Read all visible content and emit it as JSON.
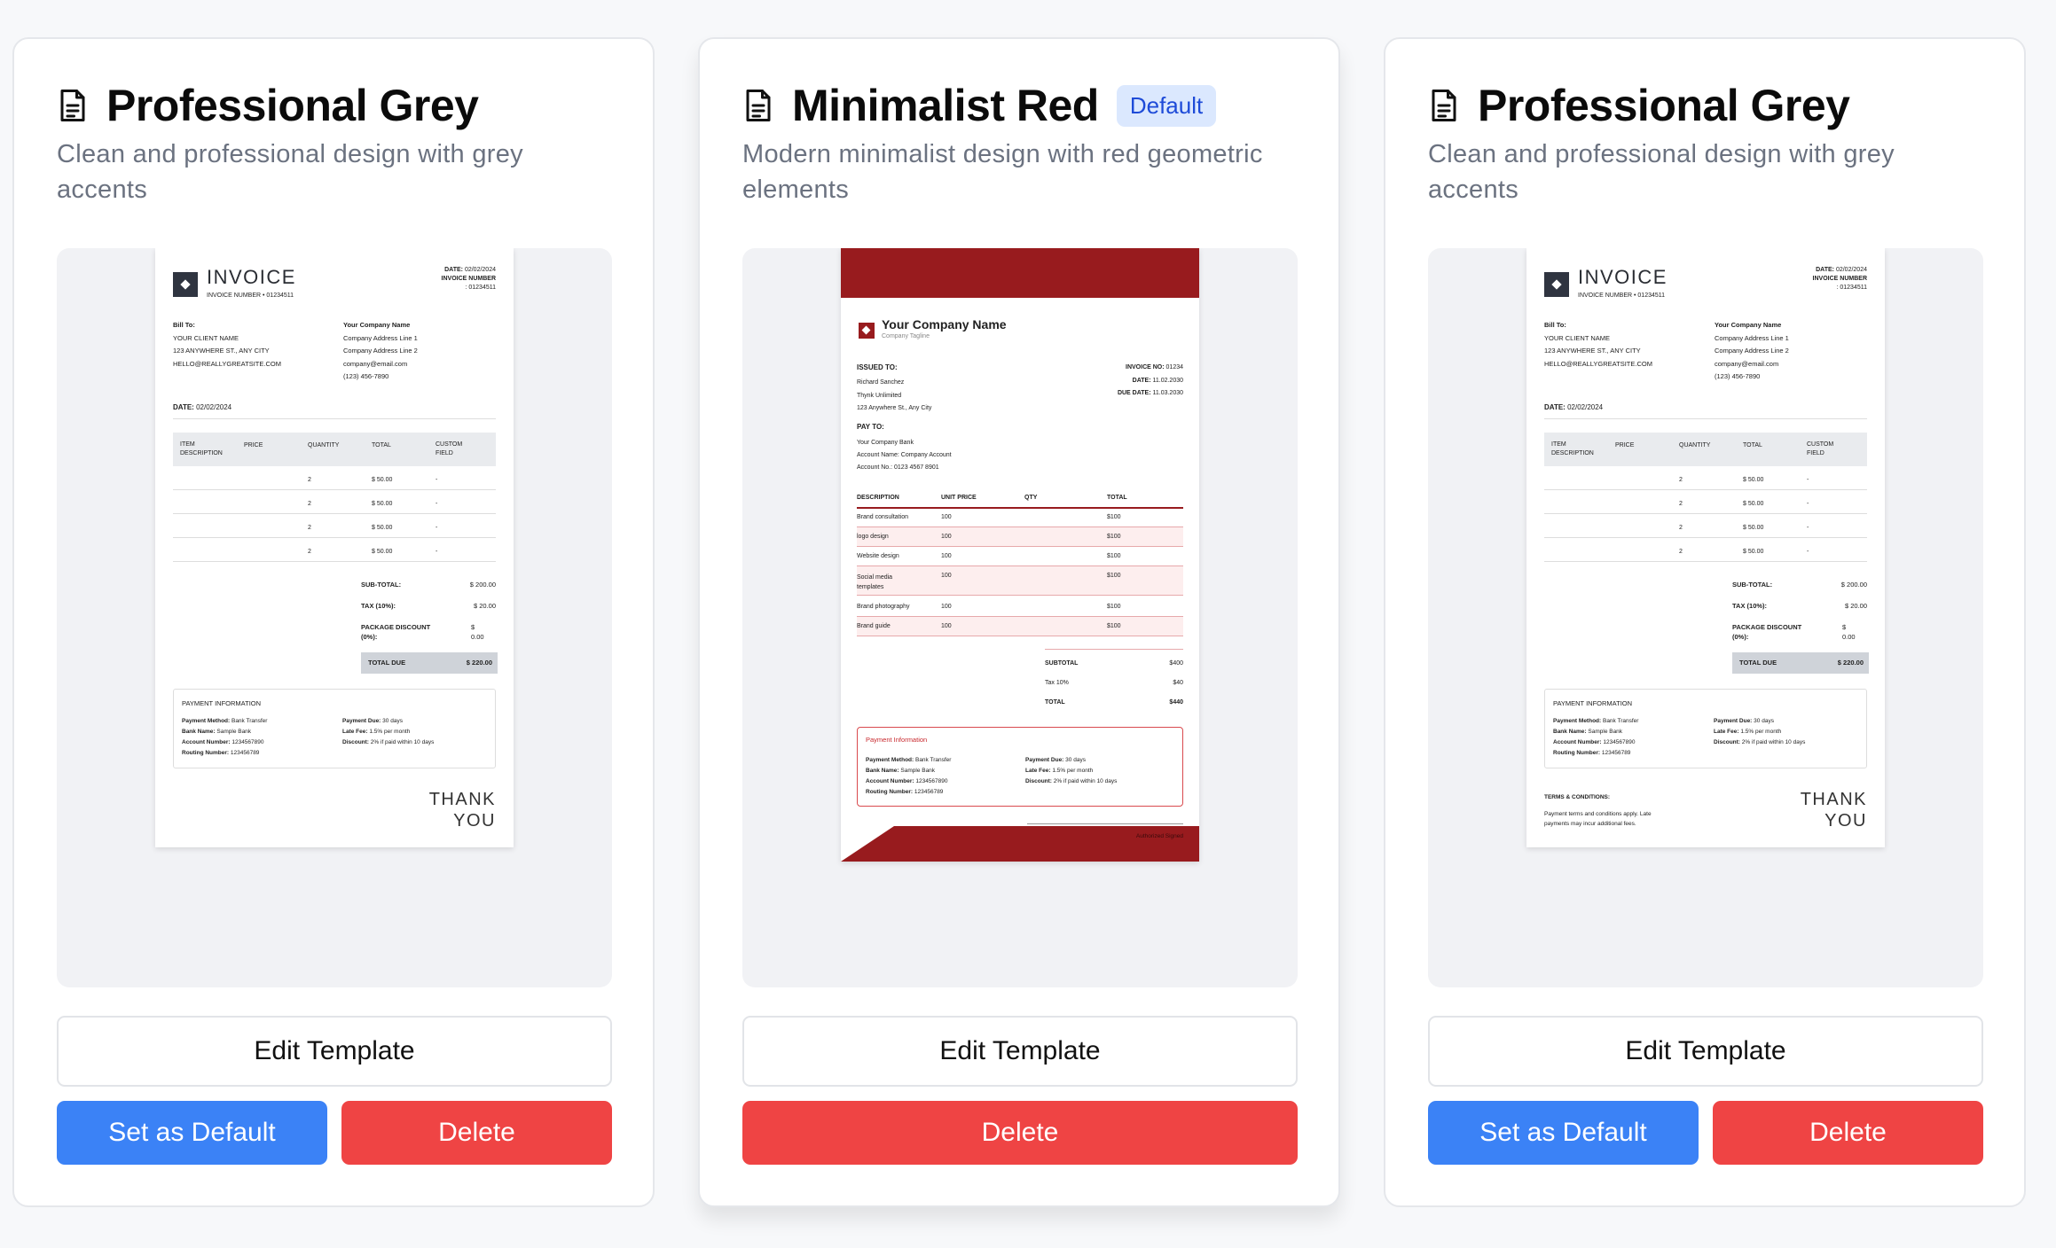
{
  "cards": [
    {
      "title": "Professional Grey",
      "description": "Clean and professional design with grey accents",
      "badge": "",
      "buttons": {
        "edit": "Edit Template",
        "set_default": "Set as Default",
        "delete": "Delete"
      }
    },
    {
      "title": "Minimalist Red",
      "description": "Modern minimalist design with red geometric elements",
      "badge": "Default",
      "buttons": {
        "edit": "Edit Template",
        "delete": "Delete"
      }
    },
    {
      "title": "Professional Grey",
      "description": "Clean and professional design with grey accents",
      "badge": "",
      "buttons": {
        "edit": "Edit Template",
        "set_default": "Set as Default",
        "delete": "Delete"
      }
    }
  ],
  "grey_invoice": {
    "title": "INVOICE",
    "invoice_number_line": "INVOICE NUMBER • 01234511",
    "date_label": "DATE:",
    "date_value": "02/02/2024",
    "inv_num_label": "INVOICE NUMBER",
    "inv_num_value": ": 01234511",
    "bill_to_label": "Bill To:",
    "client_name": "YOUR CLIENT NAME",
    "client_address": "123 ANYWHERE ST., ANY CITY",
    "client_email": "HELLO@REALLYGREATSITE.COM",
    "company_name": "Your Company Name",
    "company_line1": "Company Address Line 1",
    "company_line2": "Company Address Line 2",
    "company_email": "company@email.com",
    "company_phone": "(123) 456-7890",
    "body_date_label": "DATE:",
    "body_date_value": "02/02/2024",
    "table_headers": [
      "ITEM DESCRIPTION",
      "PRICE",
      "QUANTITY",
      "TOTAL",
      "CUSTOM FIELD"
    ],
    "rows": [
      {
        "qty": "2",
        "total": "$ 50.00",
        "custom": "-"
      },
      {
        "qty": "2",
        "total": "$ 50.00",
        "custom": "-"
      },
      {
        "qty": "2",
        "total": "$ 50.00",
        "custom": "-"
      },
      {
        "qty": "2",
        "total": "$ 50.00",
        "custom": "-"
      }
    ],
    "subtotal_label": "SUB-TOTAL:",
    "subtotal_value": "$ 200.00",
    "tax_label": "TAX (10%):",
    "tax_value": "$ 20.00",
    "discount_label1": "PACKAGE DISCOUNT",
    "discount_label2": "(0%):",
    "discount_value1": "$",
    "discount_value2": "0.00",
    "total_due_label": "TOTAL DUE",
    "total_due_value": "$ 220.00",
    "payment_title": "PAYMENT INFORMATION",
    "pay_left": [
      {
        "k": "Payment Method:",
        "v": "Bank Transfer"
      },
      {
        "k": "Bank Name:",
        "v": "Sample Bank"
      },
      {
        "k": "Account Number:",
        "v": "1234567890"
      },
      {
        "k": "Routing Number:",
        "v": "123456789"
      }
    ],
    "pay_right": [
      {
        "k": "Payment Due:",
        "v": "30 days"
      },
      {
        "k": "Late Fee:",
        "v": "1.5% per month"
      },
      {
        "k": "Discount:",
        "v": "2% if paid within 10 days"
      }
    ],
    "thank1": "THANK",
    "thank2": "YOU",
    "terms_title": "TERMS & CONDITIONS:",
    "terms_text1": "Payment terms and conditions apply. Late",
    "terms_text2": "payments may incur additional fees."
  },
  "red_invoice": {
    "company_name": "Your Company Name",
    "tagline": "Company Tagline",
    "issued_to_label": "ISSUED TO:",
    "issued_lines": [
      "Richard Sanchez",
      "Thynk Unlimited",
      "123 Anywhere St., Any City"
    ],
    "invoice_no_label": "INVOICE NO:",
    "invoice_no_value": "01234",
    "date_label": "DATE:",
    "date_value": "11.02.2030",
    "due_label": "DUE DATE:",
    "due_value": "11.03.2030",
    "pay_to_label": "PAY TO:",
    "pay_lines": [
      "Your Company Bank",
      "Account Name: Company Account",
      "Account No.: 0123 4567 8901"
    ],
    "headers": [
      "DESCRIPTION",
      "UNIT PRICE",
      "QTY",
      "TOTAL"
    ],
    "items": [
      {
        "d": "Brand consultation",
        "p": "100",
        "t": "$100"
      },
      {
        "d": "logo design",
        "p": "100",
        "t": "$100"
      },
      {
        "d": "Website design",
        "p": "100",
        "t": "$100"
      },
      {
        "d": "Social media templates",
        "p": "100",
        "t": "$100"
      },
      {
        "d": "Brand photography",
        "p": "100",
        "t": "$100"
      },
      {
        "d": "Brand guide",
        "p": "100",
        "t": "$100"
      }
    ],
    "subtotal_label": "SUBTOTAL",
    "subtotal_value": "$400",
    "tax_label": "Tax 10%",
    "tax_value": "$40",
    "total_label": "TOTAL",
    "total_value": "$440",
    "payment_title": "Payment Information",
    "pay_left": [
      {
        "k": "Payment Method:",
        "v": "Bank Transfer"
      },
      {
        "k": "Bank Name:",
        "v": "Sample Bank"
      },
      {
        "k": "Account Number:",
        "v": "1234567890"
      },
      {
        "k": "Routing Number:",
        "v": "123456789"
      }
    ],
    "pay_right": [
      {
        "k": "Payment Due:",
        "v": "30 days"
      },
      {
        "k": "Late Fee:",
        "v": "1.5% per month"
      },
      {
        "k": "Discount:",
        "v": "2% if paid within 10 days"
      }
    ],
    "signature": "Authorized Signed"
  }
}
